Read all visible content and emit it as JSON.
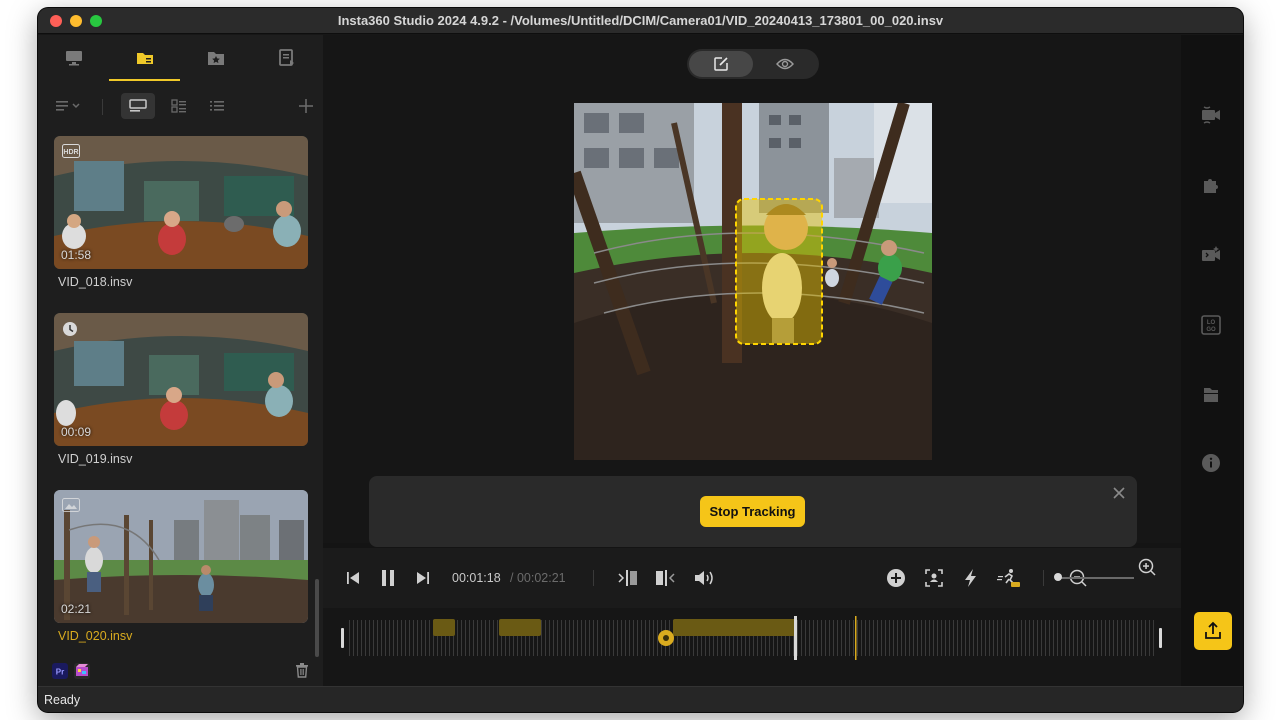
{
  "window": {
    "title": "Insta360 Studio 2024 4.9.2 - /Volumes/Untitled/DCIM/Camera01/VID_20240413_173801_00_020.insv"
  },
  "sidebar": {
    "tabs": [
      {
        "icon": "monitor-icon"
      },
      {
        "icon": "folder-icon",
        "active": true
      },
      {
        "icon": "star-folder-icon"
      },
      {
        "icon": "export-list-icon"
      }
    ],
    "view_buttons": [
      "sort-icon",
      "large-thumbnail-icon",
      "grid-list-icon",
      "list-icon",
      "add-icon"
    ],
    "clips": [
      {
        "name": "VID_018.insv",
        "duration": "01:58",
        "badge": "HDR",
        "selected": false
      },
      {
        "name": "VID_019.insv",
        "duration": "00:09",
        "badge": "timelapse-icon",
        "selected": false
      },
      {
        "name": "VID_020.insv",
        "duration": "02:21",
        "badge": "image-icon",
        "selected": true
      }
    ],
    "footer": {
      "left_icons": [
        "premiere-icon",
        "final-cut-icon"
      ],
      "right_icon": "trash-icon"
    }
  },
  "preview": {
    "mode_buttons": [
      "edit-mode-icon",
      "preview-mode-icon"
    ],
    "active_mode": "edit"
  },
  "tracking_panel": {
    "stop_label": "Stop Tracking"
  },
  "playback": {
    "current_time": "00:01:18",
    "total_time": "/ 00:02:21"
  },
  "toolbar_icons": [
    "skip-back-icon",
    "pause-icon",
    "skip-forward-icon",
    "split-left-icon",
    "split-right-icon",
    "volume-icon",
    "add-keyframe-icon",
    "deep-track-icon",
    "speed-icon",
    "runner-icon",
    "zoom-out-icon",
    "zoom-in-icon"
  ],
  "right_toolbar": [
    "camera-icon",
    "puzzle-icon",
    "video-effects-icon",
    "logo-icon",
    "folder-stack-icon",
    "info-icon",
    "export-icon"
  ],
  "colors": {
    "accent": "#f5c518",
    "clip_selected": "#d9ab1f"
  },
  "status": {
    "text": "Ready"
  }
}
